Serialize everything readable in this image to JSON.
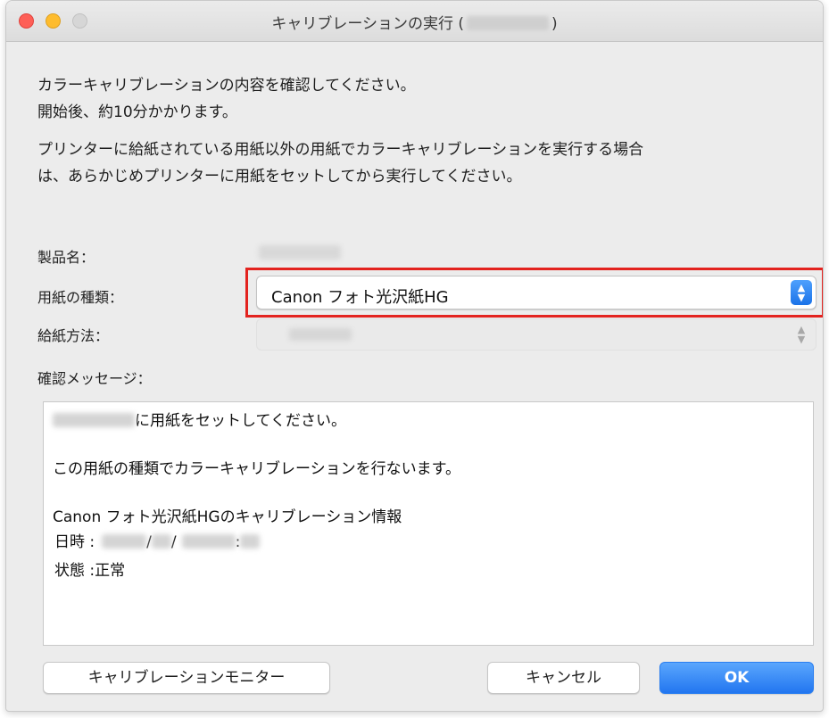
{
  "window": {
    "title_prefix": "キャリブレーションの実行 (",
    "title_suffix": ")"
  },
  "messages": {
    "line1": "カラーキャリブレーションの内容を確認してください。",
    "line2": "開始後、約10分かかります。",
    "line3": "プリンターに給紙されている用紙以外の用紙でカラーキャリブレーションを実行する場合",
    "line4": "は、あらかじめプリンターに用紙をセットしてから実行してください。"
  },
  "form": {
    "product_label": "製品名：",
    "paper_type_label": "用紙の種類：",
    "paper_type_value": "Canon フォト光沢紙HG",
    "feed_method_label": "給紙方法：",
    "confirm_label": "確認メッセージ："
  },
  "confirm_message": {
    "line1_suffix": "に用紙をセットしてください。",
    "line2": "この用紙の種類でカラーキャリブレーションを行ないます。",
    "line3": "Canon フォト光沢紙HGのキャリブレーション情報",
    "date_label": "日時 :",
    "date_sep1": "/",
    "date_sep2": "/",
    "time_sep": ":",
    "status_label": "状態 :",
    "status_value": "正常"
  },
  "buttons": {
    "monitor": "キャリブレーションモニター",
    "cancel": "キャンセル",
    "ok": "OK"
  },
  "colors": {
    "highlight": "#e3231f",
    "accent": "#2276f0"
  },
  "icons": [
    "close-icon",
    "minimize-icon",
    "zoom-icon",
    "stepper-icon"
  ]
}
